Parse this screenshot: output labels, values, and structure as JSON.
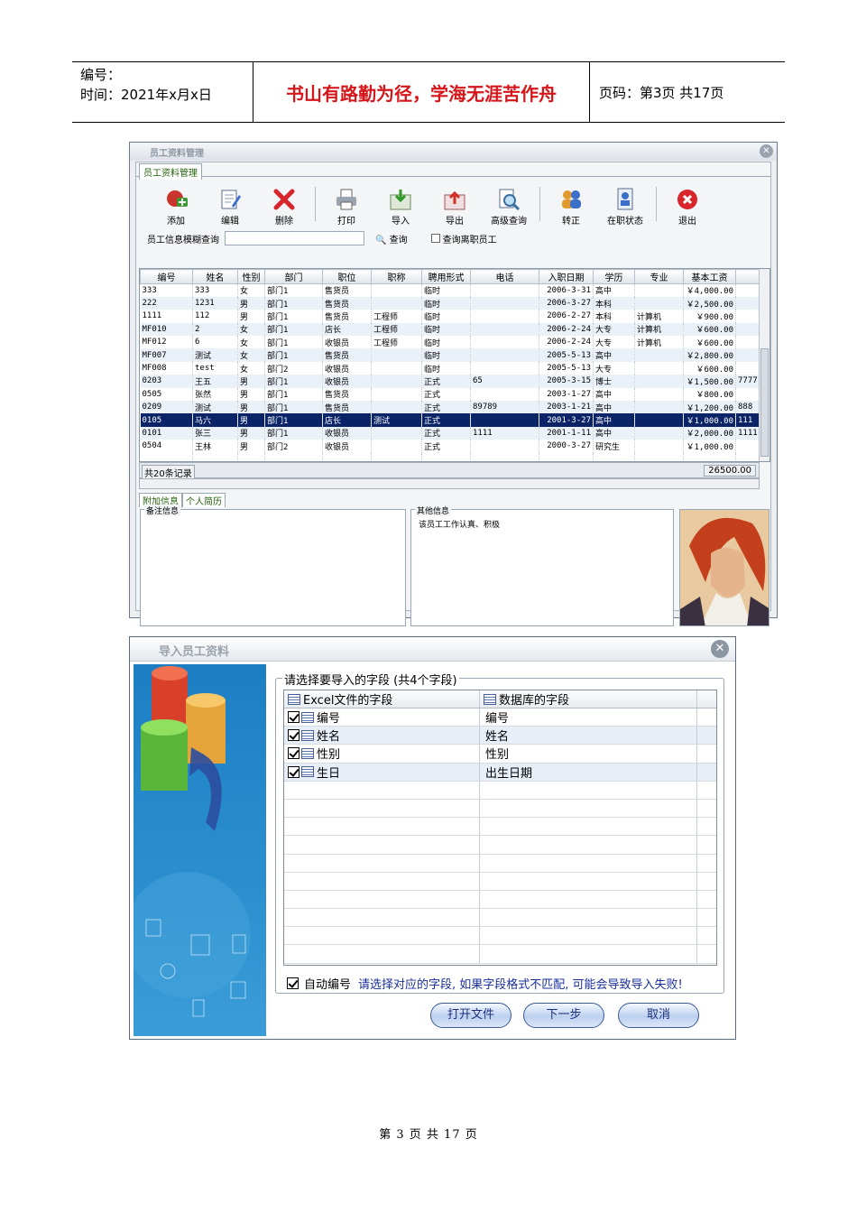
{
  "header": {
    "number_label": "编号：",
    "time_label": "时间：2021年x月x日",
    "motto": "书山有路勤为径，学海无涯苦作舟",
    "page_label": "页码：第3页  共17页"
  },
  "footer": {
    "page_text": "第 3 页 共 17 页"
  },
  "employee_window": {
    "title": "员工资料管理",
    "tab": "员工资料管理",
    "toolbar": {
      "add": "添加",
      "edit": "编辑",
      "delete": "删除",
      "print": "打印",
      "import": "导入",
      "export": "导出",
      "advanced_search": "高级查询",
      "regularize": "转正",
      "status": "在职状态",
      "exit": "退出"
    },
    "search_label": "员工信息模糊查询",
    "search_value": "",
    "search_button": "查询",
    "resigned_label": "查询离职员工",
    "columns": [
      "编号",
      "姓名",
      "性别",
      "部门",
      "职位",
      "职称",
      "聘用形式",
      "电话",
      "入职日期",
      "学历",
      "专业",
      "基本工资"
    ],
    "rows": [
      [
        "333",
        "333",
        "女",
        "部门1",
        "售货员",
        "",
        "临时",
        "",
        "2006-3-31",
        "高中",
        "",
        "￥4,000.00",
        ""
      ],
      [
        "222",
        "1231",
        "男",
        "部门1",
        "售货员",
        "",
        "临时",
        "",
        "2006-3-27",
        "本科",
        "",
        "￥2,500.00",
        ""
      ],
      [
        "1111",
        "112",
        "男",
        "部门1",
        "售货员",
        "工程师",
        "临时",
        "",
        "2006-2-27",
        "本科",
        "计算机",
        "￥900.00",
        ""
      ],
      [
        "MF010",
        "2",
        "女",
        "部门1",
        "店长",
        "工程师",
        "临时",
        "",
        "2006-2-24",
        "大专",
        "计算机",
        "￥600.00",
        ""
      ],
      [
        "MF012",
        "6",
        "女",
        "部门1",
        "收银员",
        "工程师",
        "临时",
        "",
        "2006-2-24",
        "大专",
        "计算机",
        "￥600.00",
        ""
      ],
      [
        "MF007",
        "测试",
        "女",
        "部门1",
        "售货员",
        "",
        "临时",
        "",
        "2005-5-13",
        "高中",
        "",
        "￥2,800.00",
        ""
      ],
      [
        "MF008",
        "test",
        "女",
        "部门2",
        "收银员",
        "",
        "临时",
        "",
        "2005-5-13",
        "大专",
        "",
        "￥600.00",
        ""
      ],
      [
        "0203",
        "王五",
        "男",
        "部门1",
        "收银员",
        "",
        "正式",
        "65",
        "2005-3-15",
        "博士",
        "",
        "￥1,500.00",
        "7777"
      ],
      [
        "0505",
        "张然",
        "男",
        "部门1",
        "售货员",
        "",
        "正式",
        "",
        "2003-1-27",
        "高中",
        "",
        "￥800.00",
        ""
      ],
      [
        "0209",
        "测试",
        "男",
        "部门1",
        "售货员",
        "",
        "正式",
        "89789",
        "2003-1-21",
        "高中",
        "",
        "￥1,200.00",
        "888"
      ],
      [
        "0105",
        "马六",
        "男",
        "部门1",
        "店长",
        "测试",
        "正式",
        "",
        "2001-3-27",
        "高中",
        "",
        "￥1,000.00",
        "111"
      ],
      [
        "0101",
        "张三",
        "男",
        "部门1",
        "收银员",
        "",
        "正式",
        "1111",
        "2001-1-11",
        "高中",
        "",
        "￥2,000.00",
        "1111"
      ],
      [
        "0504",
        "王林",
        "男",
        "部门2",
        "收银员",
        "",
        "正式",
        "",
        "2000-3-27",
        "研究生",
        "",
        "￥1,000.00",
        ""
      ]
    ],
    "selected_row_index": 10,
    "record_count": "共20条记录",
    "salary_total": "26500.00",
    "bottom_tabs": [
      "附加信息",
      "个人简历"
    ],
    "remarks_label": "备注信息",
    "remarks_value": "",
    "other_label": "其他信息",
    "other_value": "该员工工作认真、积极"
  },
  "import_window": {
    "title": "导入员工资料",
    "group_title": "请选择要导入的字段 (共4个字段)",
    "col_excel": "Excel文件的字段",
    "col_db": "数据库的字段",
    "fields": [
      {
        "excel": "编号",
        "db": "编号"
      },
      {
        "excel": "姓名",
        "db": "姓名"
      },
      {
        "excel": "性别",
        "db": "性别"
      },
      {
        "excel": "生日",
        "db": "出生日期"
      }
    ],
    "auto_number_label": "自动编号",
    "hint": "请选择对应的字段, 如果字段格式不匹配, 可能会导致导入失败!",
    "btn_open": "打开文件",
    "btn_next": "下一步",
    "btn_cancel": "取消"
  }
}
